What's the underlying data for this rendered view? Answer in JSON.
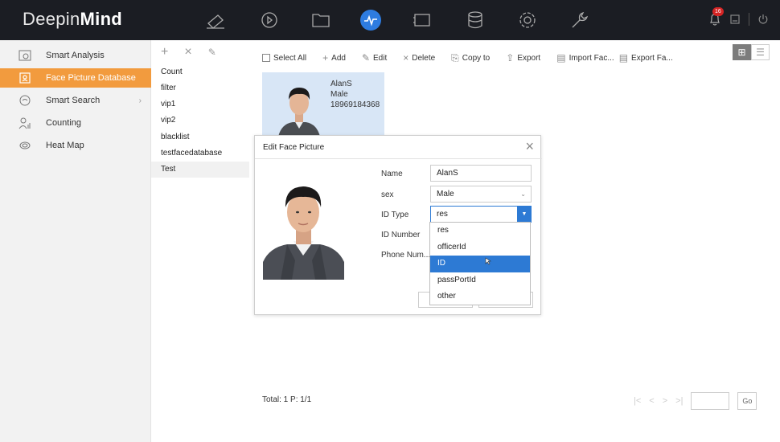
{
  "app": {
    "brand_light": "Deepin",
    "brand_bold": "Mind",
    "notifications": "16"
  },
  "topnav": [
    {
      "icon": "camera-icon"
    },
    {
      "icon": "playback-icon"
    },
    {
      "icon": "folder-icon"
    },
    {
      "icon": "smart-icon",
      "active": true
    },
    {
      "icon": "monitor-icon"
    },
    {
      "icon": "storage-icon"
    },
    {
      "icon": "settings-icon"
    },
    {
      "icon": "maintenance-icon"
    }
  ],
  "sidebar": {
    "items": [
      {
        "label": "Smart Analysis",
        "icon": "smart-analysis-icon"
      },
      {
        "label": "Face Picture Database",
        "icon": "face-database-icon",
        "active": true
      },
      {
        "label": "Smart Search",
        "icon": "smart-search-icon"
      },
      {
        "label": "Counting",
        "icon": "counting-icon"
      },
      {
        "label": "Heat Map",
        "icon": "heat-map-icon"
      }
    ]
  },
  "libraries": {
    "items": [
      "Count",
      "filter",
      "vip1",
      "vip2",
      "blacklist",
      "testfacedatabase",
      "Test"
    ],
    "selected": "Test"
  },
  "toolbar": {
    "select_all": "Select All",
    "add": "Add",
    "edit": "Edit",
    "delete": "Delete",
    "copy_to": "Copy to",
    "export": "Export",
    "import_faces": "Import Fac...",
    "export_faces": "Export Fa..."
  },
  "card": {
    "name": "AlanS",
    "sex": "Male",
    "phone": "18969184368"
  },
  "modal": {
    "title": "Edit Face Picture",
    "labels": {
      "name": "Name",
      "sex": "sex",
      "id_type": "ID Type",
      "id_number": "ID Number",
      "phone": "Phone Num..."
    },
    "values": {
      "name": "AlanS",
      "sex": "Male",
      "id_type": "res"
    }
  },
  "id_type_options": [
    "res",
    "officerId",
    "ID",
    "passPortId",
    "other"
  ],
  "id_type_highlighted": "ID",
  "footer": {
    "total": "Total: 1  P: 1/1",
    "go": "Go"
  }
}
